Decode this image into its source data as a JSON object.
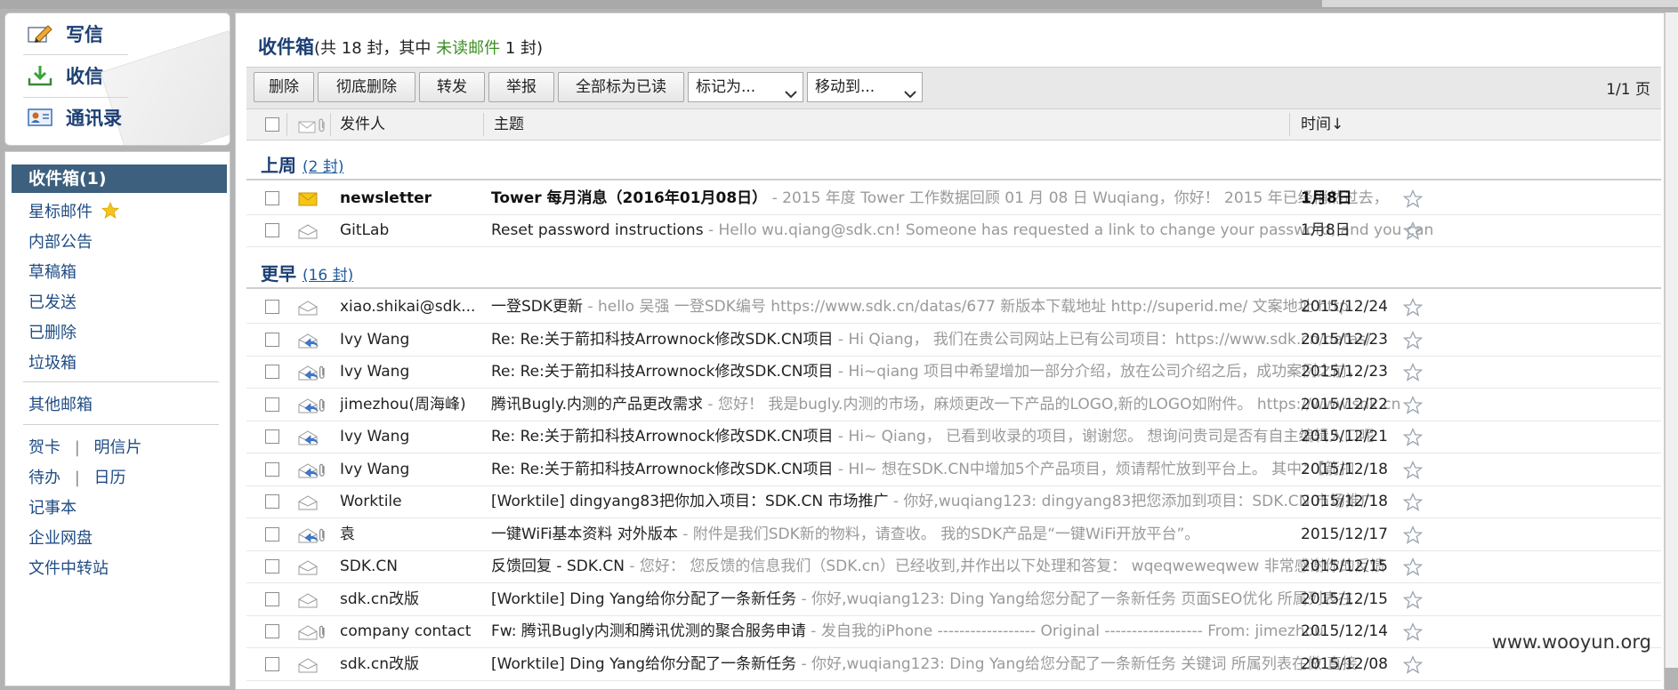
{
  "quick": {
    "compose": "写信",
    "receive": "收信",
    "contacts": "通讯录"
  },
  "folders": {
    "inbox": "收件箱(1)",
    "starred": "星标邮件",
    "notice": "内部公告",
    "drafts": "草稿箱",
    "sent": "已发送",
    "deleted": "已删除",
    "spam": "垃圾箱",
    "other": "其他邮箱",
    "card": "贺卡",
    "postcard": "明信片",
    "todo": "待办",
    "calendar": "日历",
    "notes": "记事本",
    "disk": "企业网盘",
    "transfer": "文件中转站",
    "sep": "|"
  },
  "header": {
    "title": "收件箱",
    "count_prefix": "(共 18 封，其中 ",
    "unread_link": "未读邮件",
    "count_suffix": " 1 封)"
  },
  "toolbar": {
    "delete": "删除",
    "purge": "彻底删除",
    "forward": "转发",
    "report": "举报",
    "mark_all_read": "全部标为已读",
    "mark_as": "标记为...",
    "move_to": "移动到...",
    "pager": "1/1 页"
  },
  "columns": {
    "sender": "发件人",
    "subject": "主题",
    "time": "时间↓"
  },
  "groups": [
    {
      "label": "上周",
      "count": "(2 封)"
    },
    {
      "label": "更早",
      "count": "(16 封)"
    }
  ],
  "emails": [
    {
      "sender": "newsletter",
      "subject": "Tower 每月消息（2016年01月08日）",
      "preview": " - 2015 年度 Tower 工作数据回顾 01 月 08 日 Wuqiang，你好！ 2015 年已经悄然过去，",
      "date": "1月8日",
      "unread": true
    },
    {
      "sender": "GitLab",
      "subject": "Reset password instructions",
      "preview": " - Hello wu.qiang@sdk.cn! Someone has requested a link to change your password, and you can",
      "date": "1月8日"
    },
    {
      "sender": "xiao.shikai@sdk...",
      "subject": "一登SDK更新",
      "preview": " - hello 吴强 一登SDK编号 https://www.sdk.cn/datas/677 新版本下载地址 http://superid.me/ 文案地址 http",
      "date": "2015/12/24"
    },
    {
      "sender": "Ivy Wang",
      "subject": "Re: Re:关于箭扣科技Arrownock修改SDK.CN项目",
      "preview": " - Hi Qiang， 我们在贵公司网站上已有公司项目：https://www.sdk.cn/datas/",
      "date": "2015/12/23"
    },
    {
      "sender": "Ivy Wang",
      "subject": "Re: Re:关于箭扣科技Arrownock修改SDK.CN项目",
      "preview": " - Hi~qiang 项目中希望增加一部分介绍，放在公司介绍之后，成功案例之前，",
      "date": "2015/12/23"
    },
    {
      "sender": "jimezhou(周海峰)",
      "subject": "腾讯Bugly.内测的产品更改需求",
      "preview": " - 您好！ 我是bugly.内测的市场，麻烦更改一下产品的LOGO,新的LOGO如附件。 https://www.sdk.cn",
      "date": "2015/12/22"
    },
    {
      "sender": "Ivy Wang",
      "subject": "Re: Re:关于箭扣科技Arrownock修改SDK.CN项目",
      "preview": " - Hi~ Qiang， 已看到收录的项目，谢谢您。 想询问贵司是否有自主编辑入口呢",
      "date": "2015/12/21"
    },
    {
      "sender": "Ivy Wang",
      "subject": "Re: Re:关于箭扣科技Arrownock修改SDK.CN项目",
      "preview": " - HI~ 想在SDK.CN中增加5个产品项目，烦请帮忙放到平台上。 其中：【箭扣",
      "date": "2015/12/18"
    },
    {
      "sender": "Worktile",
      "subject": "[Worktile] dingyang83把你加入项目：SDK.CN 市场推广",
      "preview": " - 你好,wuqiang123: dingyang83把您添加到项目：SDK.CN 市场推广",
      "date": "2015/12/18"
    },
    {
      "sender": "袁",
      "subject": "一键WiFi基本资料 对外版本",
      "preview": " - 附件是我们SDK新的物料，请查收。 我的SDK产品是“一键WiFi开放平台”。",
      "date": "2015/12/17"
    },
    {
      "sender": "SDK.CN",
      "subject": "反馈回复 - SDK.CN",
      "preview": " - 您好： 您反馈的信息我们（SDK.cn）已经收到,并作出以下处理和答复： wqeqweweqwew 非常感谢你的反馈",
      "date": "2015/12/15"
    },
    {
      "sender": "sdk.cn改版",
      "subject": "[Worktile] Ding Yang给你分配了一条新任务",
      "preview": " - 你好,wuqiang123: Ding Yang给您分配了一条新任务 页面SEO优化 所属列表在",
      "date": "2015/12/15"
    },
    {
      "sender": "company contact",
      "subject": "Fw: 腾讯Bugly内测和腾讯优测的聚合服务申请",
      "preview": " - 发自我的iPhone ------------------ Original ------------------ From: jimezhou",
      "date": "2015/12/14"
    },
    {
      "sender": "sdk.cn改版",
      "subject": "[Worktile] Ding Yang给你分配了一条新任务",
      "preview": " - 你好,wuqiang123: Ding Yang给您分配了一条新任务 关键词 所属列表在做 直接",
      "date": "2015/12/08"
    }
  ],
  "watermark": "www.wooyun.org"
}
